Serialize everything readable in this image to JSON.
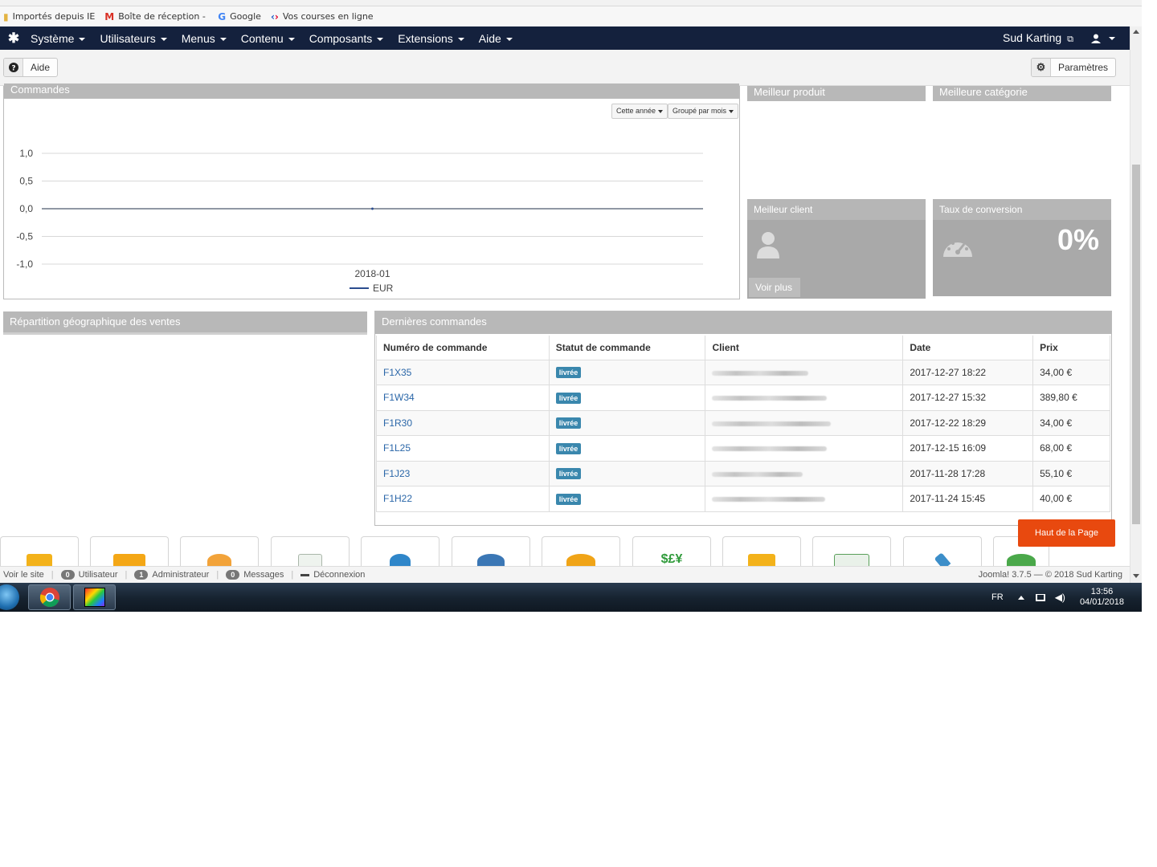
{
  "bookmarks": [
    {
      "icon": "folder-icon",
      "label": "Importés depuis IE"
    },
    {
      "icon": "gmail-icon",
      "label": "Boîte de réception -"
    },
    {
      "icon": "google-icon",
      "label": "Google"
    },
    {
      "icon": "carrefour-icon",
      "label": "Vos courses en ligne"
    }
  ],
  "navbar": {
    "menus": [
      "Système",
      "Utilisateurs",
      "Menus",
      "Contenu",
      "Composants",
      "Extensions",
      "Aide"
    ],
    "site_name": "Sud Karting"
  },
  "toolbar": {
    "help_label": "Aide",
    "options_label": "Paramètres"
  },
  "panels": {
    "commandes": "Commandes",
    "best_product": "Meilleur produit",
    "best_category": "Meilleure catégorie",
    "best_client": "Meilleur client",
    "conversion": "Taux de conversion",
    "conversion_value": "0%",
    "voir_plus": "Voir plus",
    "geo": "Répartition géographique des ventes",
    "last_orders": "Dernières commandes"
  },
  "chart_controls": {
    "period": "Cette année",
    "group": "Groupé par mois"
  },
  "chart_data": {
    "type": "line",
    "title": "",
    "xlabel": "",
    "ylabel": "",
    "x": [
      "2018-01"
    ],
    "series": [
      {
        "name": "EUR",
        "values": [
          0
        ],
        "color": "#2b4d8e"
      }
    ],
    "ylim": [
      -1.0,
      1.0
    ],
    "yticks": [
      "1,0",
      "0,5",
      "0,0",
      "-0,5",
      "-1,0"
    ],
    "grid": true,
    "legend": "bottom"
  },
  "orders": {
    "headers": [
      "Numéro de commande",
      "Statut de commande",
      "Client",
      "Date",
      "Prix"
    ],
    "rows": [
      {
        "num": "F1X35",
        "status": "livrée",
        "date": "2017-12-27 18:22",
        "price": "34,00 €"
      },
      {
        "num": "F1W34",
        "status": "livrée",
        "date": "2017-12-27 15:32",
        "price": "389,80 €"
      },
      {
        "num": "F1R30",
        "status": "livrée",
        "date": "2017-12-22 18:29",
        "price": "34,00 €"
      },
      {
        "num": "F1L25",
        "status": "livrée",
        "date": "2017-12-15 16:09",
        "price": "68,00 €"
      },
      {
        "num": "F1J23",
        "status": "livrée",
        "date": "2017-11-28 17:28",
        "price": "55,10 €"
      },
      {
        "num": "F1H22",
        "status": "livrée",
        "date": "2017-11-24 15:45",
        "price": "40,00 €"
      }
    ]
  },
  "back_to_top": "Haut de la Page",
  "quick_icons": [
    "card-icon",
    "folder-icon",
    "users-icon",
    "document-icon",
    "user-add-icon",
    "globe-icon",
    "discount-icon",
    "currency-icon",
    "plugin-icon",
    "layout-icon",
    "tools-icon",
    "update-icon"
  ],
  "statusbar": {
    "view_site": "Voir le site",
    "users_count": "0",
    "users_label": "Utilisateur",
    "admins_count": "1",
    "admins_label": "Administrateur",
    "messages_count": "0",
    "messages_label": "Messages",
    "logout": "Déconnexion",
    "version": "Joomla! 3.7.5 — © 2018 Sud Karting"
  },
  "taskbar": {
    "lang": "FR",
    "time": "13:56",
    "date": "04/01/2018"
  },
  "colors": {
    "navbar": "#14213d",
    "panel_header": "#b8b8b8",
    "accent_orange": "#e8490f",
    "badge": "#3a87ad",
    "link": "#2a66a8"
  }
}
